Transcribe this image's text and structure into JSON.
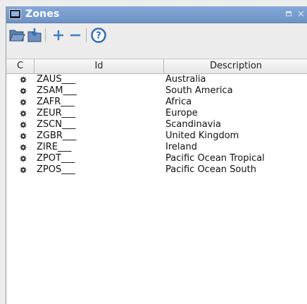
{
  "window": {
    "title": "Zones"
  },
  "columns": {
    "c": "C",
    "id": "Id",
    "description": "Description"
  },
  "rows": [
    {
      "id": "ZAUS___",
      "description": "Australia"
    },
    {
      "id": "ZSAM___",
      "description": "South America"
    },
    {
      "id": "ZAFR___",
      "description": "Africa"
    },
    {
      "id": "ZEUR___",
      "description": "Europe"
    },
    {
      "id": "ZSCN___",
      "description": "Scandinavia"
    },
    {
      "id": "ZGBR___",
      "description": "United Kingdom"
    },
    {
      "id": "ZIRE___",
      "description": "Ireland"
    },
    {
      "id": "ZPOT___",
      "description": "Pacific Ocean Tropical"
    },
    {
      "id": "ZPOS___",
      "description": "Pacific Ocean South"
    }
  ],
  "icons": {
    "title": "window-icon",
    "toolbar": [
      "open-folder-icon",
      "import-icon",
      "add-icon",
      "remove-icon",
      "help-icon"
    ],
    "row": "gear-icon"
  },
  "colors": {
    "titlebar": "#7a9ccc",
    "add": "#3f7fc7",
    "help": "#2f6fb8"
  }
}
